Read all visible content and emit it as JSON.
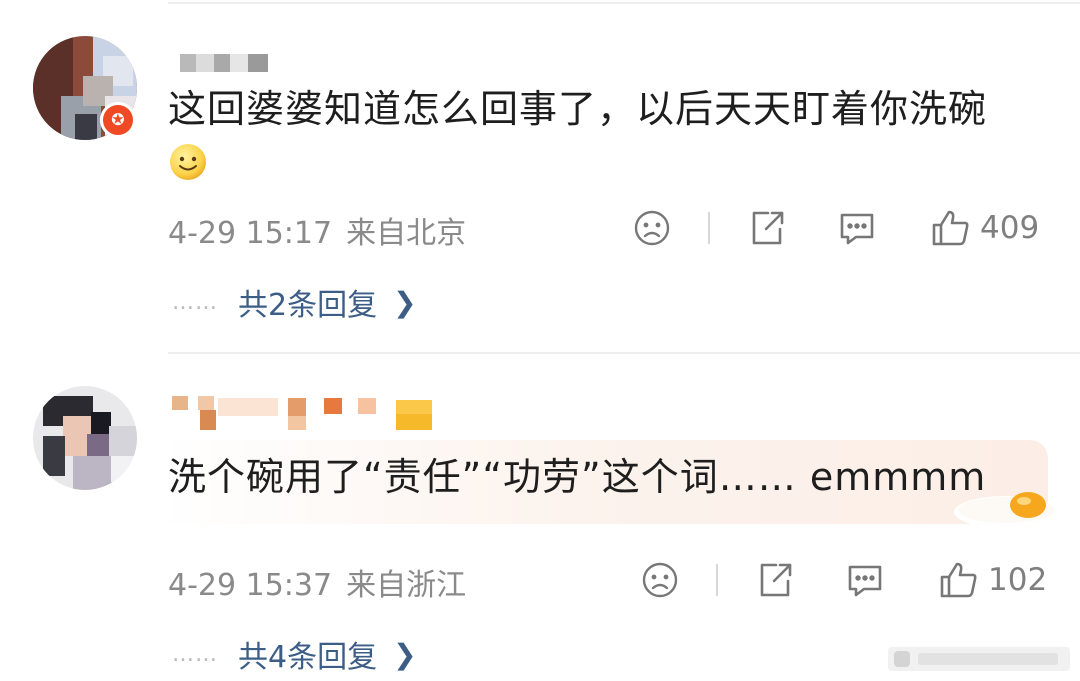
{
  "comments": [
    {
      "text": "这回婆婆知道怎么回事了，以后天天盯着你洗碗",
      "emoji_icon": "smile-emoji-icon",
      "time": "4-29 15:17",
      "location": "来自北京",
      "likes": "409",
      "replies_label": "共2条回复",
      "dots": "……"
    },
    {
      "text": "洗个碗用了“责任”“功劳”这个词…… emmmm",
      "decoration_icon": "fried-egg-icon",
      "time": "4-29 15:37",
      "location": "来自浙江",
      "likes": "102",
      "replies_label": "共4条回复",
      "dots": "……"
    }
  ],
  "icons": {
    "dislike": "sad-face-icon",
    "share": "share-icon",
    "comment": "comment-bubble-icon",
    "like": "thumbs-up-icon",
    "chevron": "chevron-right-icon"
  },
  "colors": {
    "link": "#3c5e86",
    "meta": "#8a8a8a",
    "badge": "#f04a24"
  }
}
